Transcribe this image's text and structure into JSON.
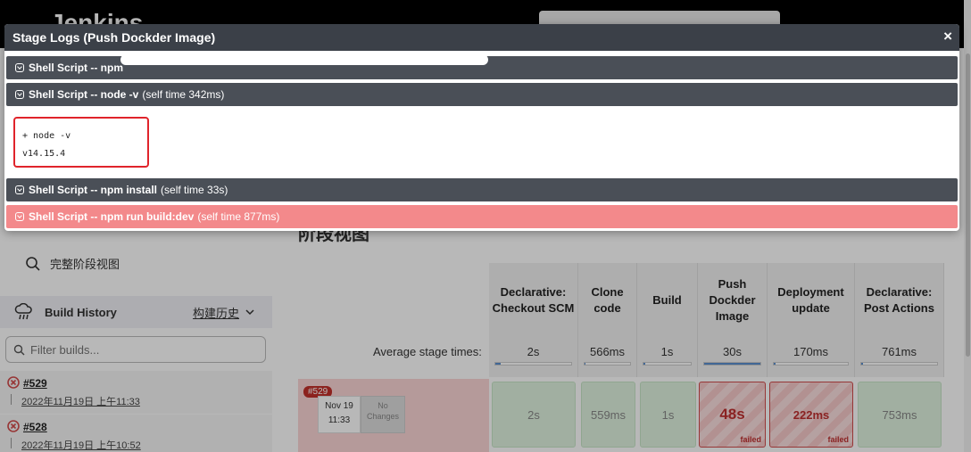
{
  "app": {
    "logo_text": "Jenkins"
  },
  "modal": {
    "title": "Stage Logs (Push Dockder Image)",
    "close_label": "×",
    "steps": [
      {
        "label": "Shell Script -- npm",
        "time": "",
        "status": "ok"
      },
      {
        "label": "Shell Script -- node -v",
        "time": "(self time 342ms)",
        "status": "ok",
        "expanded": true
      },
      {
        "label": "Shell Script -- npm install",
        "time": "(self time 33s)",
        "status": "ok"
      },
      {
        "label": "Shell Script -- npm run build:dev",
        "time": "(self time 877ms)",
        "status": "failed"
      }
    ],
    "log_lines": [
      "+ node -v",
      "v14.15.4"
    ]
  },
  "sidebar": {
    "stage_view_link": "完整阶段视图",
    "build_history": {
      "title": "Build History",
      "title_zh": "构建历史",
      "filter_placeholder": "Filter builds..."
    },
    "builds": [
      {
        "number": "#529",
        "date": "2022年11月19日 上午11:33"
      },
      {
        "number": "#528",
        "date": "2022年11月19日 上午10:52"
      }
    ]
  },
  "stage_view": {
    "title": "阶段视图",
    "avg_label": "Average stage times:",
    "stages": [
      {
        "name": "Declarative: Checkout SCM",
        "avg": "2s",
        "fill": 0.07
      },
      {
        "name": "Clone code",
        "avg": "566ms",
        "fill": 0.02
      },
      {
        "name": "Build",
        "avg": "1s",
        "fill": 0.03
      },
      {
        "name": "Push Dockder Image",
        "avg": "30s",
        "fill": 1.0
      },
      {
        "name": "Deployment update",
        "avg": "170ms",
        "fill": 0.01
      },
      {
        "name": "Declarative: Post Actions",
        "avg": "761ms",
        "fill": 0.02
      }
    ],
    "run": {
      "badge": "#529",
      "date": "Nov 19",
      "time": "11:33",
      "changes": "No Changes",
      "cells": [
        "2s",
        "559ms",
        "1s",
        "48s",
        "222ms",
        "753ms"
      ],
      "failed_label": "failed"
    }
  },
  "colors": {
    "header": "#3b4048",
    "step": "#4a4f57",
    "failed_step": "#f3898b",
    "highlight": "#e0242b"
  }
}
